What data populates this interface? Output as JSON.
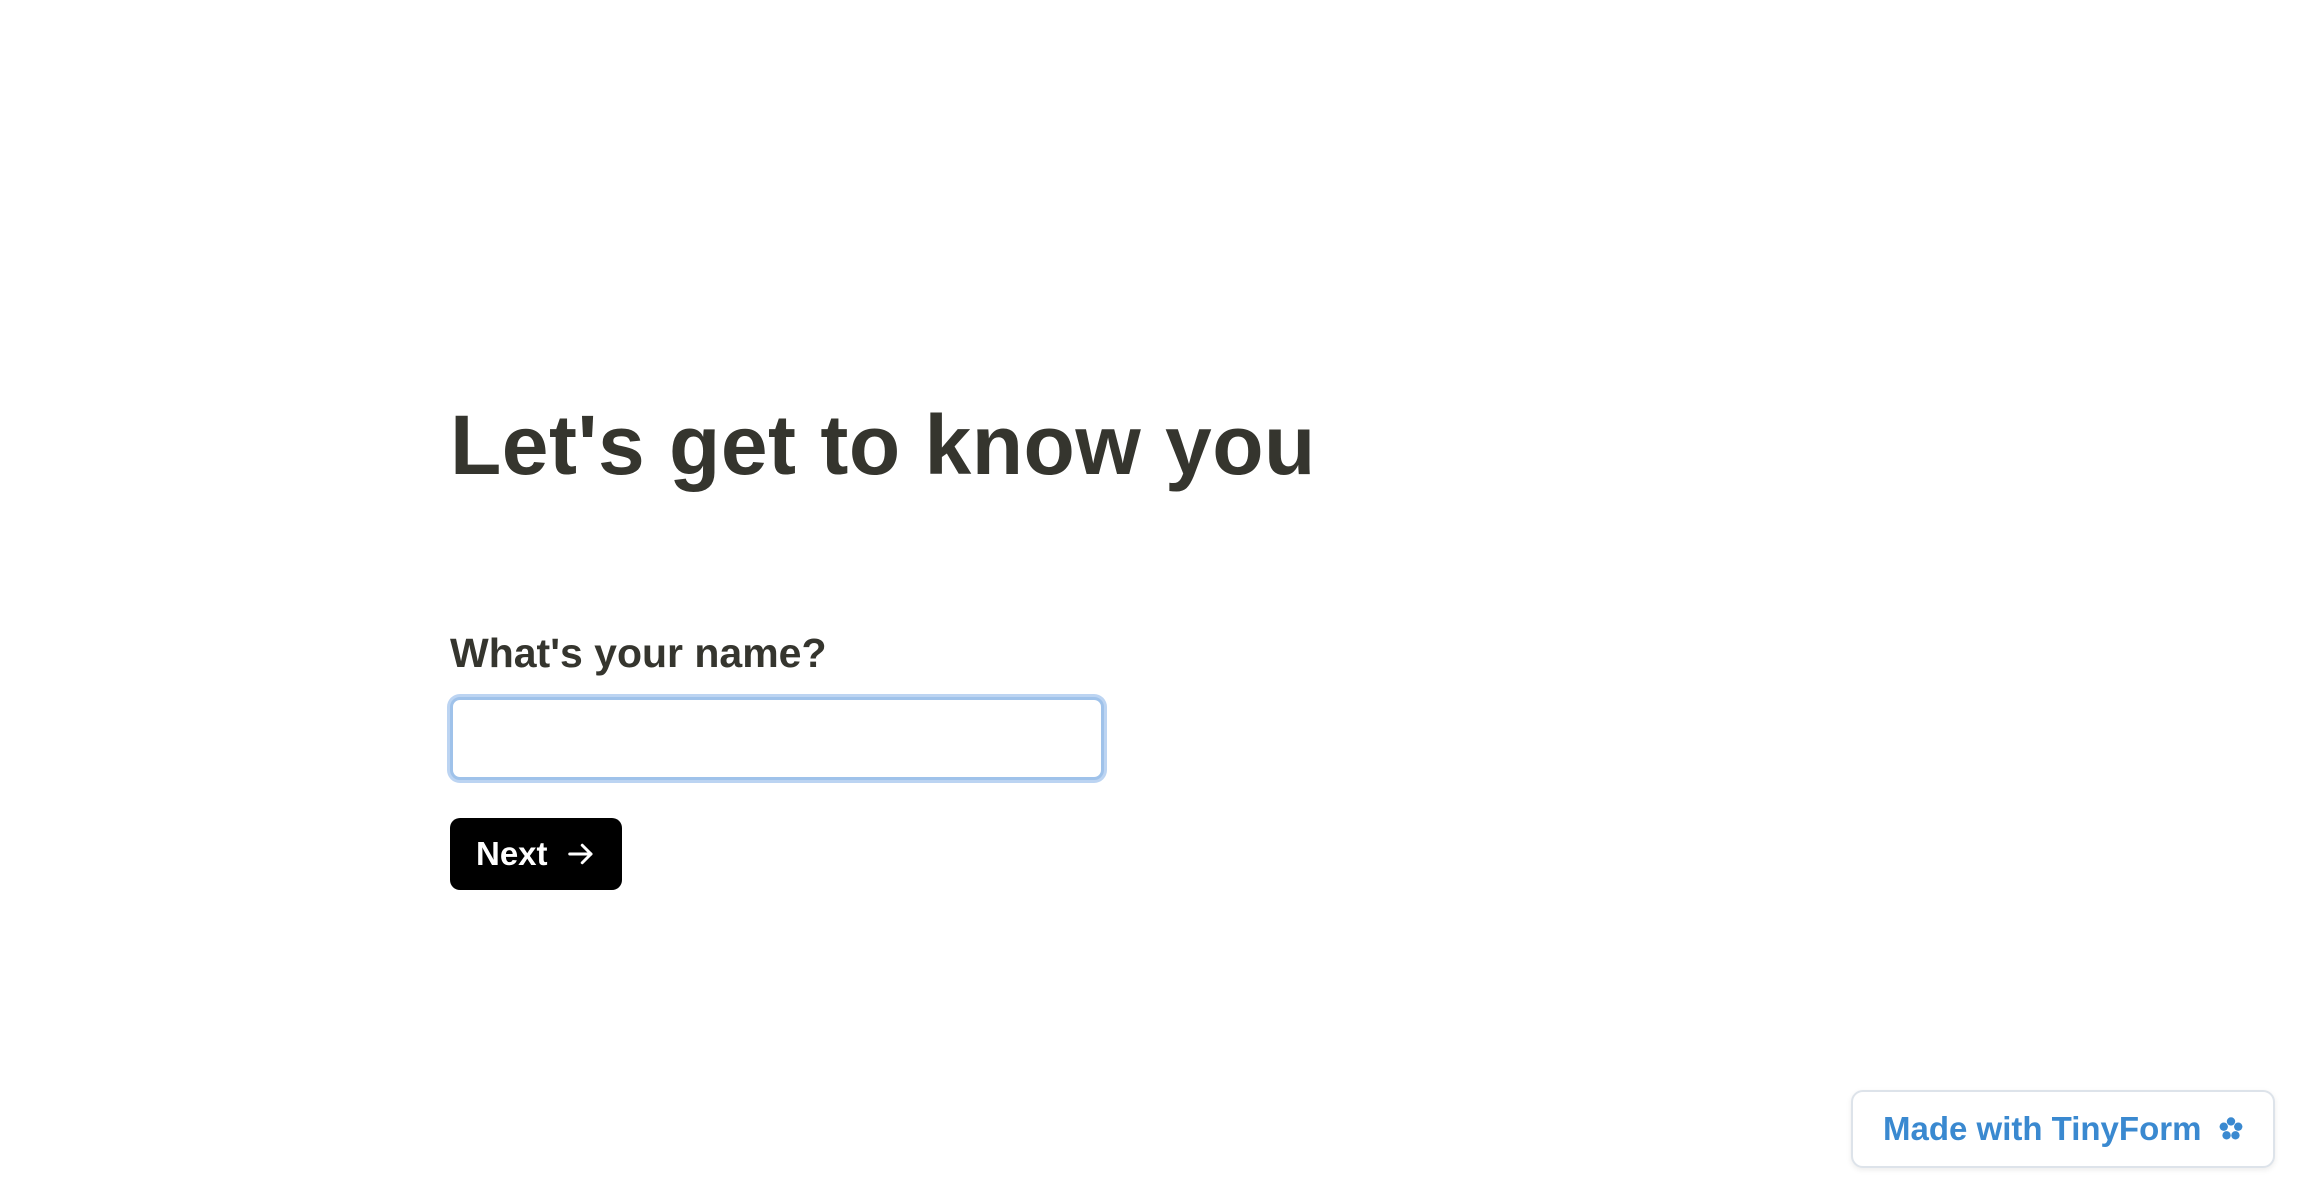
{
  "form": {
    "title": "Let's get to know you",
    "question_label": "What's your name?",
    "name_input": {
      "value": "",
      "placeholder": ""
    },
    "next_button": {
      "label": "Next",
      "icon": "arrow-right-icon"
    }
  },
  "badge": {
    "label": "Made with TinyForm",
    "icon": "flower-icon"
  },
  "colors": {
    "text": "#35352e",
    "button_bg": "#000000",
    "button_text": "#ffffff",
    "input_focus_border": "#9fc2ea",
    "badge_text": "#3a89d0",
    "background": "#ffffff"
  }
}
